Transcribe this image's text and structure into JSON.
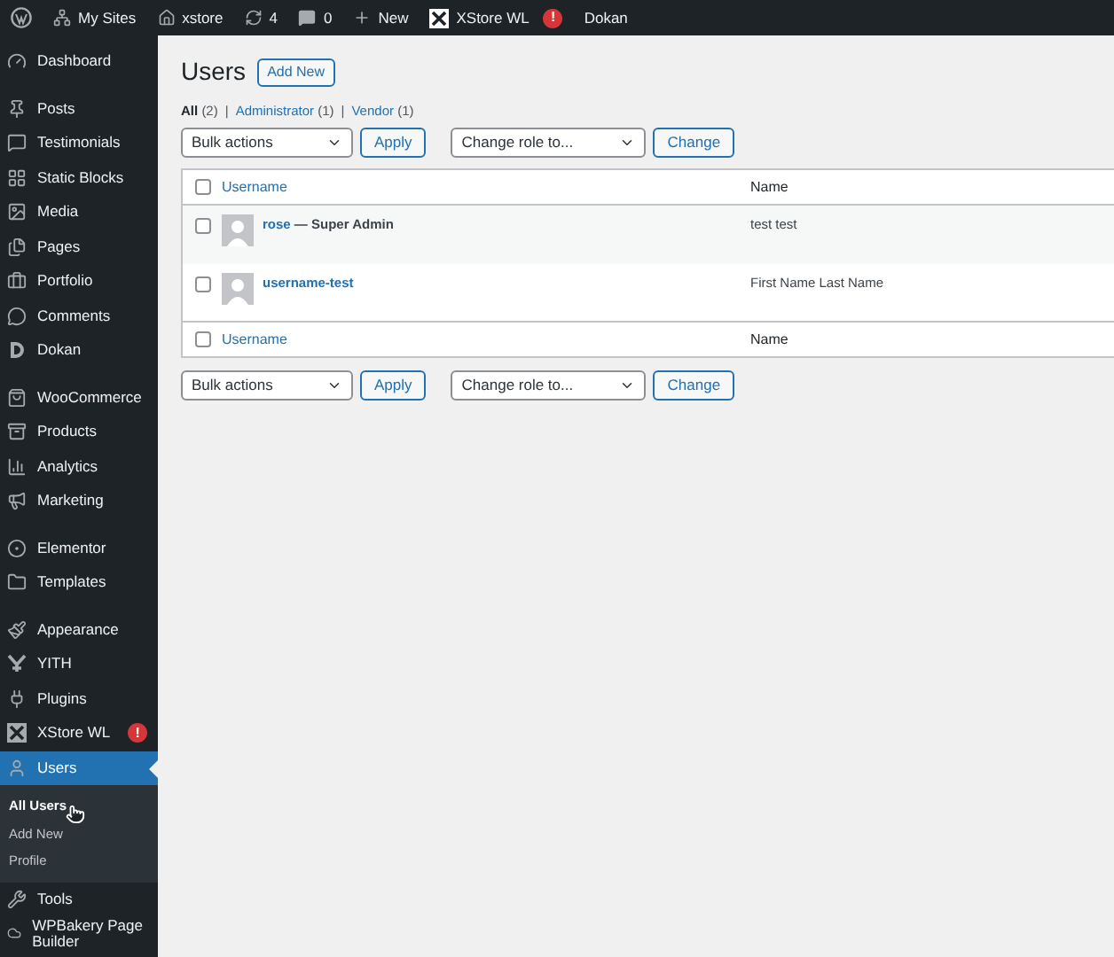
{
  "admin_bar": [
    {
      "kind": "logo"
    },
    {
      "kind": "sites",
      "label": "My Sites"
    },
    {
      "kind": "home",
      "label": "xstore"
    },
    {
      "kind": "updates",
      "label": "4"
    },
    {
      "kind": "comments",
      "label": "0"
    },
    {
      "kind": "new",
      "label": "New"
    },
    {
      "kind": "xstore",
      "label": "XStore WL",
      "badge": "!"
    },
    {
      "kind": "plain",
      "label": "Dokan"
    }
  ],
  "sidebar": {
    "groups": [
      {
        "items": [
          {
            "label": "Dashboard",
            "selected": false
          }
        ]
      },
      {
        "items": [
          {
            "label": "Posts",
            "selected": false
          },
          {
            "label": "Testimonials",
            "selected": false
          },
          {
            "label": "Static Blocks",
            "selected": false
          },
          {
            "label": "Media",
            "selected": false
          },
          {
            "label": "Pages",
            "selected": false
          },
          {
            "label": "Portfolio",
            "selected": false
          },
          {
            "label": "Comments",
            "selected": false
          },
          {
            "label": "Dokan",
            "selected": false
          }
        ]
      },
      {
        "items": [
          {
            "label": "WooCommerce",
            "selected": false
          },
          {
            "label": "Products",
            "selected": false
          },
          {
            "label": "Analytics",
            "selected": false
          },
          {
            "label": "Marketing",
            "selected": false
          }
        ]
      },
      {
        "items": [
          {
            "label": "Elementor",
            "selected": false
          },
          {
            "label": "Templates",
            "selected": false
          }
        ]
      },
      {
        "items": [
          {
            "label": "Appearance",
            "selected": false
          },
          {
            "label": "YITH",
            "selected": false
          },
          {
            "label": "Plugins",
            "selected": false
          },
          {
            "label": "XStore WL",
            "selected": false,
            "badge": "!"
          },
          {
            "label": "Users",
            "selected": true,
            "children": [
              {
                "label": "All Users",
                "selected": true
              },
              {
                "label": "Add New",
                "selected": false
              },
              {
                "label": "Profile",
                "selected": false
              }
            ]
          },
          {
            "label": "Tools",
            "selected": false
          },
          {
            "label": "WPBakery Page Builder",
            "selected": false
          }
        ]
      }
    ]
  },
  "page": {
    "title": "Users",
    "add_button": "Add New"
  },
  "views": [
    {
      "label": "All",
      "count": "(2)",
      "selected": true
    },
    {
      "separator": "|",
      "label": "Administrator",
      "count": "(1)",
      "selected": false
    },
    {
      "separator": "|",
      "label": "Vendor",
      "count": "(1)",
      "selected": false
    }
  ],
  "top_actions": {
    "bulk": "Bulk actions",
    "apply": "Apply",
    "role": "Change role to...",
    "change": "Change"
  },
  "table": {
    "columns": [
      "Username",
      "Name"
    ],
    "header_checked": false,
    "footer_checked": false,
    "rows": [
      {
        "username": "rose",
        "role": " — Super Admin",
        "name": "test test",
        "checked": false
      },
      {
        "username": "username-test",
        "name": "First Name Last Name",
        "checked": false
      }
    ],
    "footer": [
      "Username",
      "Name"
    ]
  },
  "bottom_actions": {
    "bulk": "Bulk actions",
    "apply": "Apply",
    "role": "Change role to...",
    "change": "Change"
  }
}
